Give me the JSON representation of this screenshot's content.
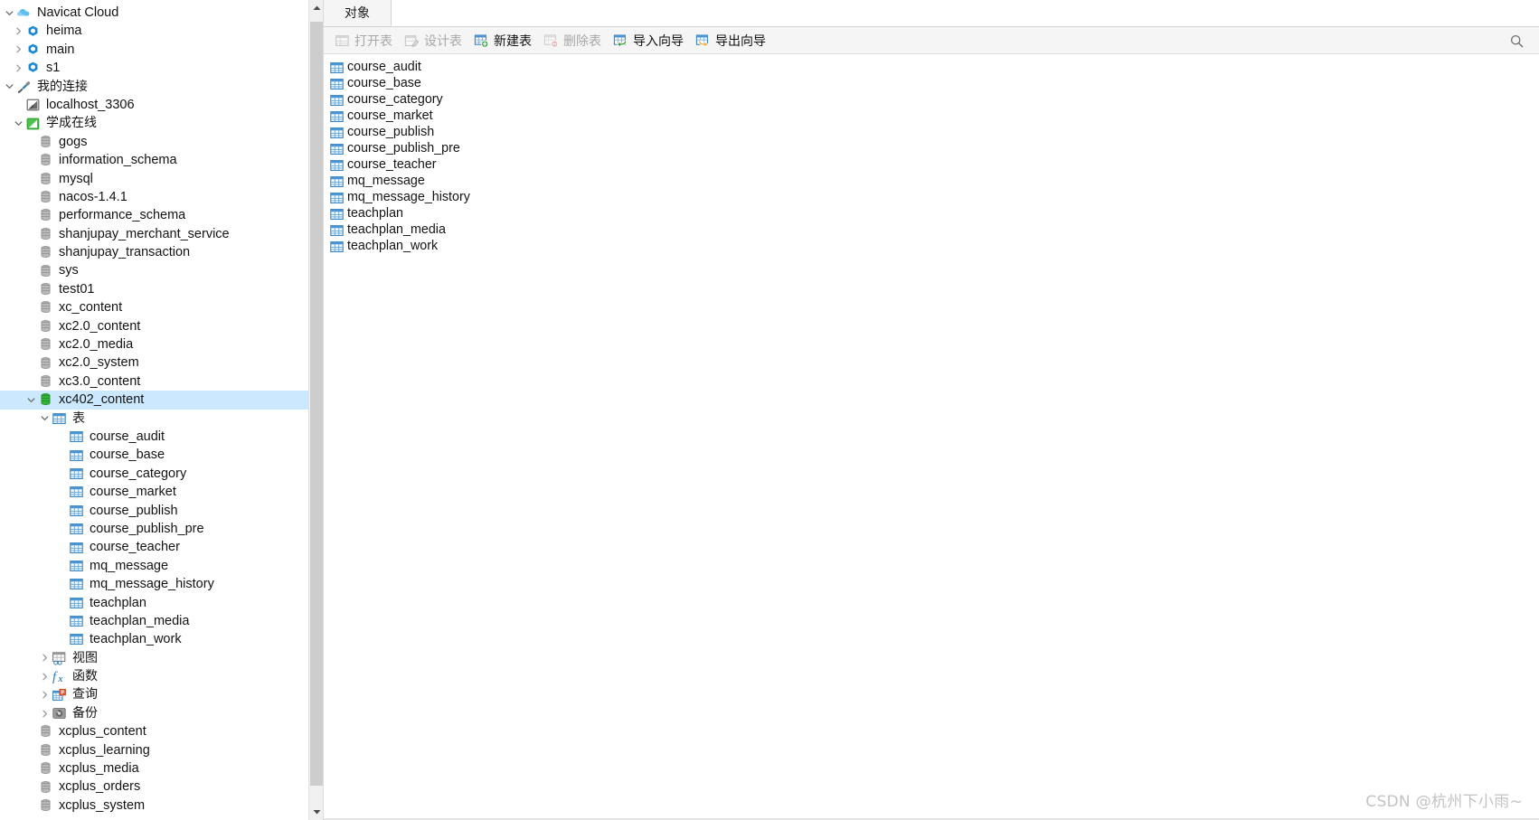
{
  "sidebar": {
    "nodes": [
      {
        "label": "Navicat Cloud",
        "icon": "cloud-icon",
        "level": 0,
        "twisty": "down",
        "selected": false
      },
      {
        "label": "heima",
        "icon": "cloud-project-icon",
        "level": 1,
        "twisty": "right",
        "selected": false
      },
      {
        "label": "main",
        "icon": "cloud-project-icon",
        "level": 1,
        "twisty": "right",
        "selected": false
      },
      {
        "label": "s1",
        "icon": "cloud-project-icon",
        "level": 1,
        "twisty": "right",
        "selected": false
      },
      {
        "label": "我的连接",
        "icon": "connection-group-icon",
        "level": 0,
        "twisty": "down",
        "selected": false,
        "cjk": true
      },
      {
        "label": "localhost_3306",
        "icon": "mysql-conn-gray-icon",
        "level": 1,
        "twisty": "none",
        "selected": false
      },
      {
        "label": "学成在线",
        "icon": "mysql-conn-green-icon",
        "level": 1,
        "twisty": "down",
        "selected": false,
        "cjk": true
      },
      {
        "label": "gogs",
        "icon": "database-gray-icon",
        "level": 2,
        "twisty": "none",
        "selected": false
      },
      {
        "label": "information_schema",
        "icon": "database-gray-icon",
        "level": 2,
        "twisty": "none",
        "selected": false
      },
      {
        "label": "mysql",
        "icon": "database-gray-icon",
        "level": 2,
        "twisty": "none",
        "selected": false
      },
      {
        "label": "nacos-1.4.1",
        "icon": "database-gray-icon",
        "level": 2,
        "twisty": "none",
        "selected": false
      },
      {
        "label": "performance_schema",
        "icon": "database-gray-icon",
        "level": 2,
        "twisty": "none",
        "selected": false
      },
      {
        "label": "shanjupay_merchant_service",
        "icon": "database-gray-icon",
        "level": 2,
        "twisty": "none",
        "selected": false
      },
      {
        "label": "shanjupay_transaction",
        "icon": "database-gray-icon",
        "level": 2,
        "twisty": "none",
        "selected": false
      },
      {
        "label": "sys",
        "icon": "database-gray-icon",
        "level": 2,
        "twisty": "none",
        "selected": false
      },
      {
        "label": "test01",
        "icon": "database-gray-icon",
        "level": 2,
        "twisty": "none",
        "selected": false
      },
      {
        "label": "xc_content",
        "icon": "database-gray-icon",
        "level": 2,
        "twisty": "none",
        "selected": false
      },
      {
        "label": "xc2.0_content",
        "icon": "database-gray-icon",
        "level": 2,
        "twisty": "none",
        "selected": false
      },
      {
        "label": "xc2.0_media",
        "icon": "database-gray-icon",
        "level": 2,
        "twisty": "none",
        "selected": false
      },
      {
        "label": "xc2.0_system",
        "icon": "database-gray-icon",
        "level": 2,
        "twisty": "none",
        "selected": false
      },
      {
        "label": "xc3.0_content",
        "icon": "database-gray-icon",
        "level": 2,
        "twisty": "none",
        "selected": false
      },
      {
        "label": "xc402_content",
        "icon": "database-green-icon",
        "level": 2,
        "twisty": "down",
        "selected": true
      },
      {
        "label": "表",
        "icon": "tables-folder-icon",
        "level": 3,
        "twisty": "down",
        "selected": false,
        "cjk": true
      },
      {
        "label": "course_audit",
        "icon": "table-icon",
        "level": 4,
        "twisty": "none",
        "selected": false
      },
      {
        "label": "course_base",
        "icon": "table-icon",
        "level": 4,
        "twisty": "none",
        "selected": false
      },
      {
        "label": "course_category",
        "icon": "table-icon",
        "level": 4,
        "twisty": "none",
        "selected": false
      },
      {
        "label": "course_market",
        "icon": "table-icon",
        "level": 4,
        "twisty": "none",
        "selected": false
      },
      {
        "label": "course_publish",
        "icon": "table-icon",
        "level": 4,
        "twisty": "none",
        "selected": false
      },
      {
        "label": "course_publish_pre",
        "icon": "table-icon",
        "level": 4,
        "twisty": "none",
        "selected": false
      },
      {
        "label": "course_teacher",
        "icon": "table-icon",
        "level": 4,
        "twisty": "none",
        "selected": false
      },
      {
        "label": "mq_message",
        "icon": "table-icon",
        "level": 4,
        "twisty": "none",
        "selected": false
      },
      {
        "label": "mq_message_history",
        "icon": "table-icon",
        "level": 4,
        "twisty": "none",
        "selected": false
      },
      {
        "label": "teachplan",
        "icon": "table-icon",
        "level": 4,
        "twisty": "none",
        "selected": false
      },
      {
        "label": "teachplan_media",
        "icon": "table-icon",
        "level": 4,
        "twisty": "none",
        "selected": false
      },
      {
        "label": "teachplan_work",
        "icon": "table-icon",
        "level": 4,
        "twisty": "none",
        "selected": false
      },
      {
        "label": "视图",
        "icon": "views-icon",
        "level": 3,
        "twisty": "right",
        "selected": false,
        "cjk": true
      },
      {
        "label": "函数",
        "icon": "functions-icon",
        "level": 3,
        "twisty": "right",
        "selected": false,
        "cjk": true
      },
      {
        "label": "查询",
        "icon": "queries-icon",
        "level": 3,
        "twisty": "right",
        "selected": false,
        "cjk": true
      },
      {
        "label": "备份",
        "icon": "backups-icon",
        "level": 3,
        "twisty": "right",
        "selected": false,
        "cjk": true
      },
      {
        "label": "xcplus_content",
        "icon": "database-gray-icon",
        "level": 2,
        "twisty": "none",
        "selected": false
      },
      {
        "label": "xcplus_learning",
        "icon": "database-gray-icon",
        "level": 2,
        "twisty": "none",
        "selected": false
      },
      {
        "label": "xcplus_media",
        "icon": "database-gray-icon",
        "level": 2,
        "twisty": "none",
        "selected": false
      },
      {
        "label": "xcplus_orders",
        "icon": "database-gray-icon",
        "level": 2,
        "twisty": "none",
        "selected": false
      },
      {
        "label": "xcplus_system",
        "icon": "database-gray-icon",
        "level": 2,
        "twisty": "none",
        "selected": false
      }
    ]
  },
  "tabs": [
    {
      "label": "对象",
      "active": true
    }
  ],
  "toolbar": {
    "buttons": [
      {
        "label": "打开表",
        "icon": "open-table-icon",
        "disabled": true
      },
      {
        "label": "设计表",
        "icon": "design-table-icon",
        "disabled": true
      },
      {
        "label": "新建表",
        "icon": "new-table-icon",
        "disabled": false
      },
      {
        "label": "删除表",
        "icon": "delete-table-icon",
        "disabled": true
      },
      {
        "label": "导入向导",
        "icon": "import-wizard-icon",
        "disabled": false
      },
      {
        "label": "导出向导",
        "icon": "export-wizard-icon",
        "disabled": false
      }
    ],
    "search_icon": "search-icon"
  },
  "object_list": {
    "items": [
      {
        "label": "course_audit",
        "icon": "table-icon"
      },
      {
        "label": "course_base",
        "icon": "table-icon"
      },
      {
        "label": "course_category",
        "icon": "table-icon"
      },
      {
        "label": "course_market",
        "icon": "table-icon"
      },
      {
        "label": "course_publish",
        "icon": "table-icon"
      },
      {
        "label": "course_publish_pre",
        "icon": "table-icon"
      },
      {
        "label": "course_teacher",
        "icon": "table-icon"
      },
      {
        "label": "mq_message",
        "icon": "table-icon"
      },
      {
        "label": "mq_message_history",
        "icon": "table-icon"
      },
      {
        "label": "teachplan",
        "icon": "table-icon"
      },
      {
        "label": "teachplan_media",
        "icon": "table-icon"
      },
      {
        "label": "teachplan_work",
        "icon": "table-icon"
      }
    ]
  },
  "watermark": {
    "text": "CSDN @杭州下小雨~"
  },
  "colors": {
    "selection": "#cce8ff",
    "table_icon": "#3a86c8",
    "db_green": "#2eaa3c",
    "toolbar_bg": "#f5f5f5",
    "disabled_text": "#a8a8a8"
  }
}
